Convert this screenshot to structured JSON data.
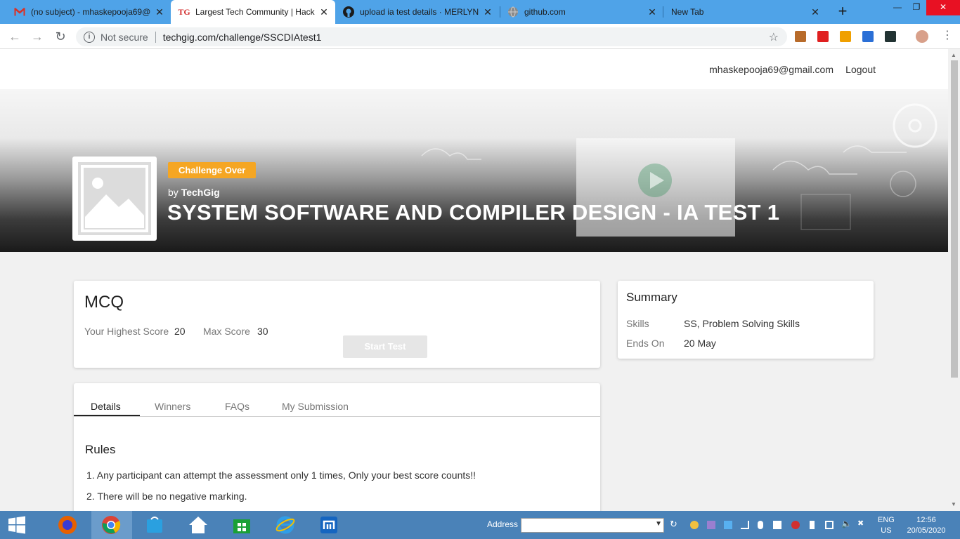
{
  "browser": {
    "tabs": [
      {
        "title": "(no subject) - mhaskepooja69@",
        "favicon": "gmail-icon"
      },
      {
        "title": "Largest Tech Community | Hack",
        "favicon": "techgig-icon",
        "active": true
      },
      {
        "title": "upload ia test details · MERLYN",
        "favicon": "github-icon"
      },
      {
        "title": "github.com",
        "favicon": "globe-icon"
      },
      {
        "title": "New Tab",
        "favicon": "none"
      }
    ],
    "security_label": "Not secure",
    "url": "techgig.com/challenge/SSCDIAtest1",
    "tab_logo_text": "TG"
  },
  "site": {
    "user_email": "mhaskepooja69@gmail.com",
    "logout_label": "Logout"
  },
  "challenge": {
    "status_badge": "Challenge Over",
    "by_prefix": "by",
    "organizer": "TechGig",
    "title": "SYSTEM SOFTWARE AND COMPILER DESIGN - IA TEST 1"
  },
  "mcq": {
    "heading": "MCQ",
    "highest_score_label": "Your Highest Score",
    "highest_score_value": "20",
    "max_score_label": "Max Score",
    "max_score_value": "30",
    "start_button": "Start Test"
  },
  "summary": {
    "heading": "Summary",
    "skills_label": "Skills",
    "skills_value": "SS, Problem Solving Skills",
    "ends_label": "Ends On",
    "ends_value": "20 May"
  },
  "details": {
    "tabs": [
      "Details",
      "Winners",
      "FAQs",
      "My Submission"
    ],
    "rules_heading": "Rules",
    "rules": [
      "1.  Any participant can attempt the assessment only 1 times, Only your best score counts!!",
      "2.  There will be no negative marking."
    ]
  },
  "taskbar": {
    "address_label": "Address",
    "language": "ENG",
    "region": "US",
    "time": "12:56",
    "date": "20/05/2020"
  },
  "colors": {
    "chrome_tabstrip": "#4fa3e8",
    "badge": "#f5a623",
    "taskbar": "#4a82b8"
  }
}
